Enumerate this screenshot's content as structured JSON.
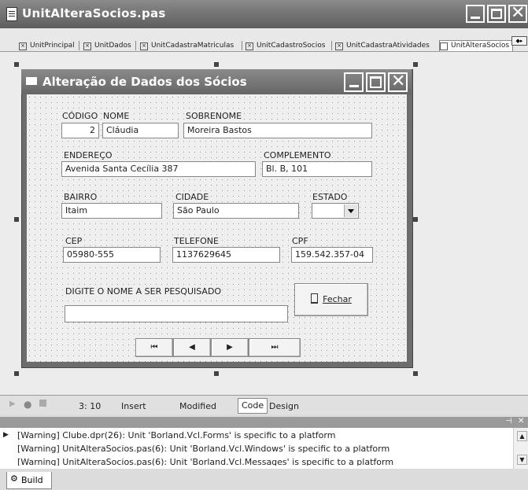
{
  "ide": {
    "title": "UnitAlteraSocios.pas"
  },
  "tabs": [
    {
      "label": "UnitPrincipal"
    },
    {
      "label": "UnitDados"
    },
    {
      "label": "UnitCadastraMatriculas"
    },
    {
      "label": "UnitCadastroSocios"
    },
    {
      "label": "UnitCadastraAtividades"
    },
    {
      "label": "UnitAlteraSocios"
    }
  ],
  "form": {
    "title": "Alteração de Dados dos Sócios",
    "labels": {
      "codigo": "CÓDIGO",
      "nome": "NOME",
      "sobrenome": "SOBRENOME",
      "endereco": "ENDEREÇO",
      "complemento": "COMPLEMENTO",
      "bairro": "BAIRRO",
      "cidade": "CIDADE",
      "estado": "ESTADO",
      "cep": "CEP",
      "telefone": "TELEFONE",
      "cpf": "CPF",
      "pesquisa": "DIGITE O NOME A SER PESQUISADO"
    },
    "values": {
      "codigo": "2",
      "nome": "Cláudia",
      "sobrenome": "Moreira Bastos",
      "endereco": "Avenida Santa Cecília 387",
      "complemento": "Bl. B, 101",
      "bairro": "Itaim",
      "cidade": "São Paulo",
      "estado": "",
      "cep": "05980-555",
      "telefone": "1137629645",
      "cpf": "159.542.357-04",
      "pesquisa": ""
    },
    "fechar_label": "Fechar",
    "nav": {
      "first": "⏮",
      "prior": "◀",
      "next": "▶",
      "last": "⏭"
    }
  },
  "status": {
    "position": "3: 10",
    "mode": "Insert",
    "state": "Modified",
    "tab_code": "Code",
    "tab_design": "Design"
  },
  "messages": [
    "[Warning] Clube.dpr(26): Unit 'Borland.Vcl.Forms' is specific to a platform",
    "[Warning] UnitAlteraSocios.pas(6): Unit 'Borland.Vcl.Windows' is specific to a platform",
    "[Warning] UnitAlteraSocios.pas(6): Unit 'Borland.Vcl.Messages' is specific to a platform"
  ],
  "build_tab": "Build"
}
